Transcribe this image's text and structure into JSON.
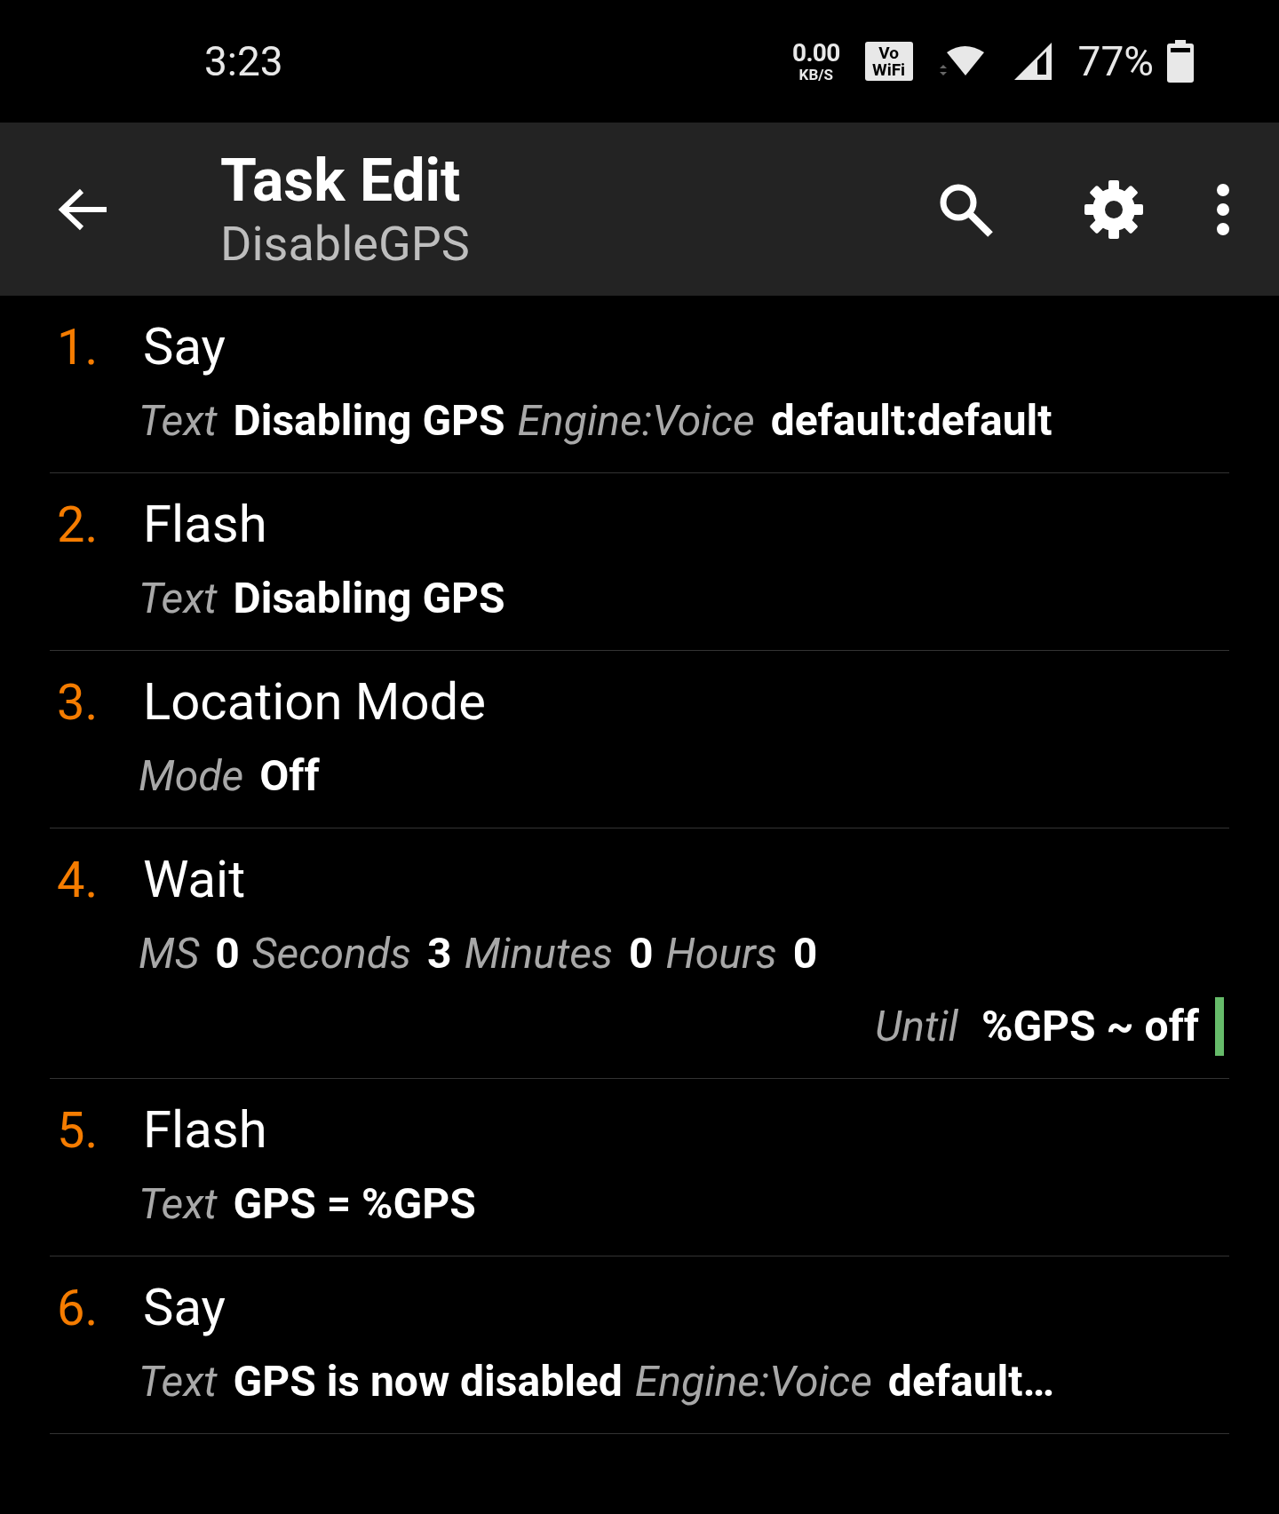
{
  "status_bar": {
    "time": "3:23",
    "net_speed": "0.00",
    "net_unit": "KB/S",
    "vowifi_top": "Vo",
    "vowifi_bottom": "WiFi",
    "battery": "77%"
  },
  "header": {
    "title": "Task Edit",
    "subtitle": "DisableGPS"
  },
  "actions": [
    {
      "number": "1.",
      "name": "Say",
      "params": [
        {
          "label": "Text",
          "value": "Disabling GPS"
        },
        {
          "label": "Engine:Voice",
          "value": "default:default"
        }
      ]
    },
    {
      "number": "2.",
      "name": "Flash",
      "params": [
        {
          "label": "Text",
          "value": "Disabling GPS"
        }
      ]
    },
    {
      "number": "3.",
      "name": "Location Mode",
      "params": [
        {
          "label": "Mode",
          "value": "Off"
        }
      ]
    },
    {
      "number": "4.",
      "name": "Wait",
      "params": [
        {
          "label": "MS",
          "value": "0"
        },
        {
          "label": "Seconds",
          "value": "3"
        },
        {
          "label": "Minutes",
          "value": "0"
        },
        {
          "label": "Hours",
          "value": "0"
        }
      ],
      "condition": {
        "label": "Until",
        "value": "%GPS ~ off",
        "color": "#66bb6a"
      }
    },
    {
      "number": "5.",
      "name": "Flash",
      "params": [
        {
          "label": "Text",
          "value": "GPS = %GPS"
        }
      ]
    },
    {
      "number": "6.",
      "name": "Say",
      "params": [
        {
          "label": "Text",
          "value": "GPS is now disabled"
        },
        {
          "label": "Engine:Voice",
          "value": "default…"
        }
      ]
    }
  ]
}
